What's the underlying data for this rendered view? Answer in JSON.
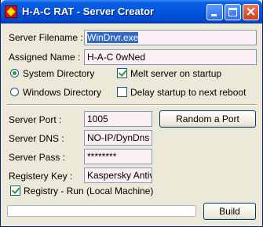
{
  "window": {
    "title": "H-A-C RAT - Server Creator",
    "minimize_icon": "minimize-icon",
    "maximize_icon": "maximize-icon",
    "close_icon": "close-icon",
    "close_glyph": "×"
  },
  "server_filename": {
    "label": "Server Filename :",
    "value": "WinDrvr.exe"
  },
  "assigned_name": {
    "label": "Assigned Name :",
    "value": "H-A-C 0wNed"
  },
  "directory": {
    "system": {
      "label": "System Directory",
      "selected": true
    },
    "windows": {
      "label": "Windows Directory",
      "selected": false
    }
  },
  "melt_server": {
    "label": "Melt server on startup",
    "checked": true
  },
  "delay_startup": {
    "label": "Delay startup to next reboot",
    "checked": false
  },
  "server_port": {
    "label": "Server Port :",
    "value": "1005"
  },
  "random_port_button": "Random a Port",
  "server_dns": {
    "label": "Server DNS :",
    "value": "NO-IP/DynDns"
  },
  "server_pass": {
    "label": "Server Pass :",
    "value": "********"
  },
  "registry_key": {
    "label": "Registery Key :",
    "value": "Kaspersky Antivir"
  },
  "registry_run": {
    "label": "Registry - Run (Local Machine)",
    "checked": true
  },
  "progress": {
    "percent": 0
  },
  "build_button": "Build",
  "colors": {
    "titlebar": "#0054e3",
    "face": "#ece9d8",
    "field_pink": "#fbeef4",
    "selection": "#316ac5",
    "check_green": "#21a121"
  }
}
